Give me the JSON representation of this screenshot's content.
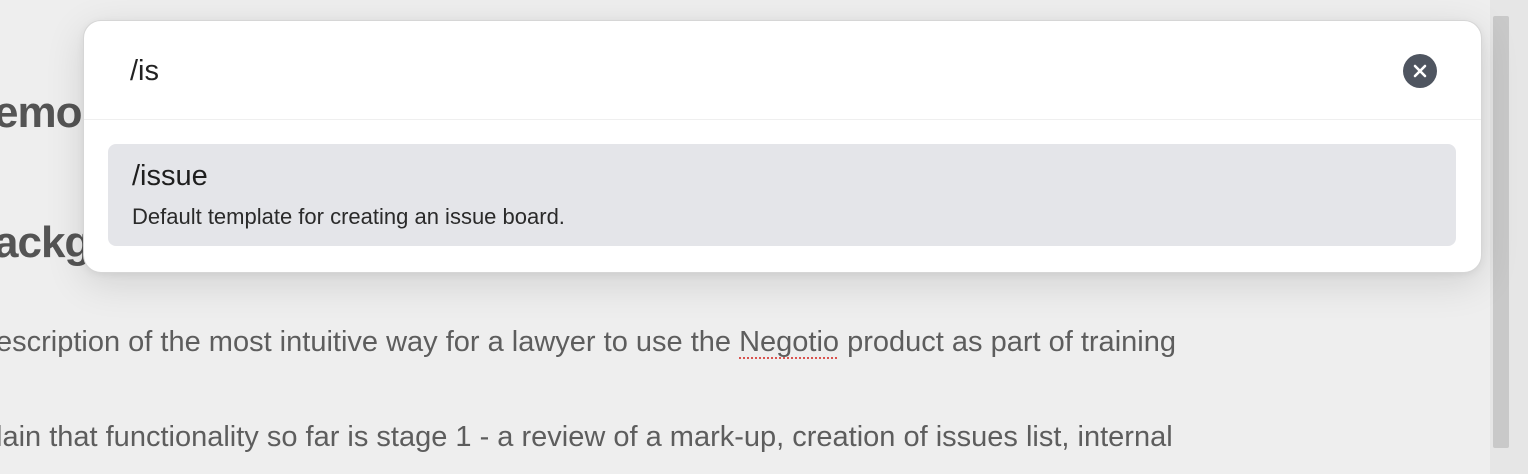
{
  "document": {
    "heading_1": "emo",
    "heading_2": "ackg",
    "paragraph_1_start": "escription of the most intuitive way for a lawyer to use the ",
    "paragraph_1_spell": "Negotio",
    "paragraph_1_end": " product as part of training",
    "paragraph_2": "lain that functionality so far is stage 1 - a review of a mark-up, creation of issues list, internal"
  },
  "palette": {
    "search_value": "/is",
    "clear_icon": "close-circle-icon",
    "results": [
      {
        "title": "/issue",
        "description": "Default template for creating an issue board."
      }
    ]
  },
  "colors": {
    "selected_item_bg": "#e4e5e9",
    "clear_button_bg": "#4f5560",
    "spellcheck_underline": "#d9534f"
  }
}
